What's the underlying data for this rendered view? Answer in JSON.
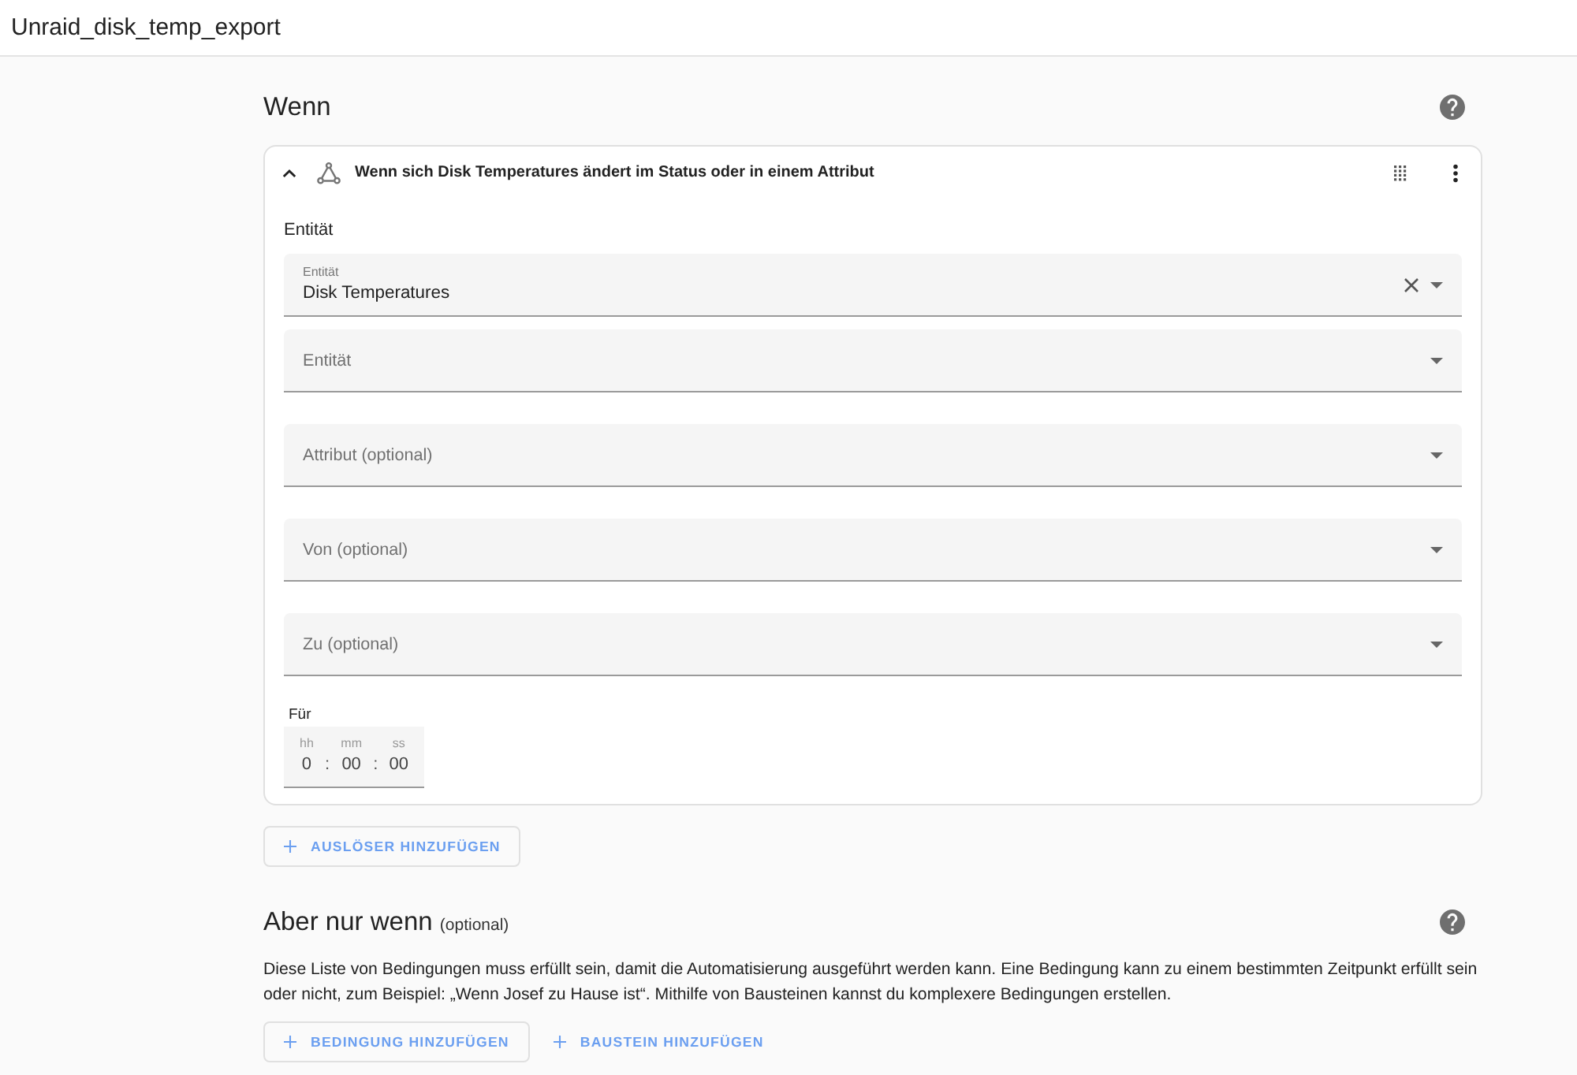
{
  "page_title": "Unraid_disk_temp_export",
  "triggers_section": {
    "heading": "Wenn",
    "trigger": {
      "expanded": true,
      "title": "Wenn sich Disk Temperatures ändert im Status oder in einem Attribut",
      "entity_picker": {
        "label": "Entität",
        "entries": [
          {
            "label": "Entität",
            "value": "Disk Temperatures",
            "clearable": true
          },
          {
            "label": "Entität",
            "clearable": false
          }
        ]
      },
      "fields": [
        {
          "label": "Attribut (optional)",
          "clearable": false
        },
        {
          "label": "Von (optional)",
          "clearable": false
        },
        {
          "label": "Zu (optional)",
          "clearable": false
        }
      ],
      "duration": {
        "label": "Für",
        "separator": ":",
        "units": [
          {
            "label": "hh",
            "value": "0"
          },
          {
            "label": "mm",
            "value": "00"
          },
          {
            "label": "ss",
            "value": "00"
          }
        ]
      }
    },
    "add_button": "AUSLÖSER HINZUFÜGEN"
  },
  "conditions_section": {
    "heading": "Aber nur wenn",
    "heading_note": "(optional)",
    "description": "Diese Liste von Bedingungen muss erfüllt sein, damit die Automatisierung ausgeführt werden kann. Eine Bedingung kann zu einem bestimmten Zeitpunkt erfüllt sein oder nicht, zum Beispiel: „Wenn Josef zu Hause ist“. Mithilfe von Bausteinen kannst du komplexere Bedingungen erstellen.",
    "buttons": [
      {
        "kind": "outlined",
        "label": "BEDINGUNG HINZUFÜGEN"
      },
      {
        "kind": "text",
        "label": "BAUSTEIN HINZUFÜGEN"
      }
    ]
  }
}
